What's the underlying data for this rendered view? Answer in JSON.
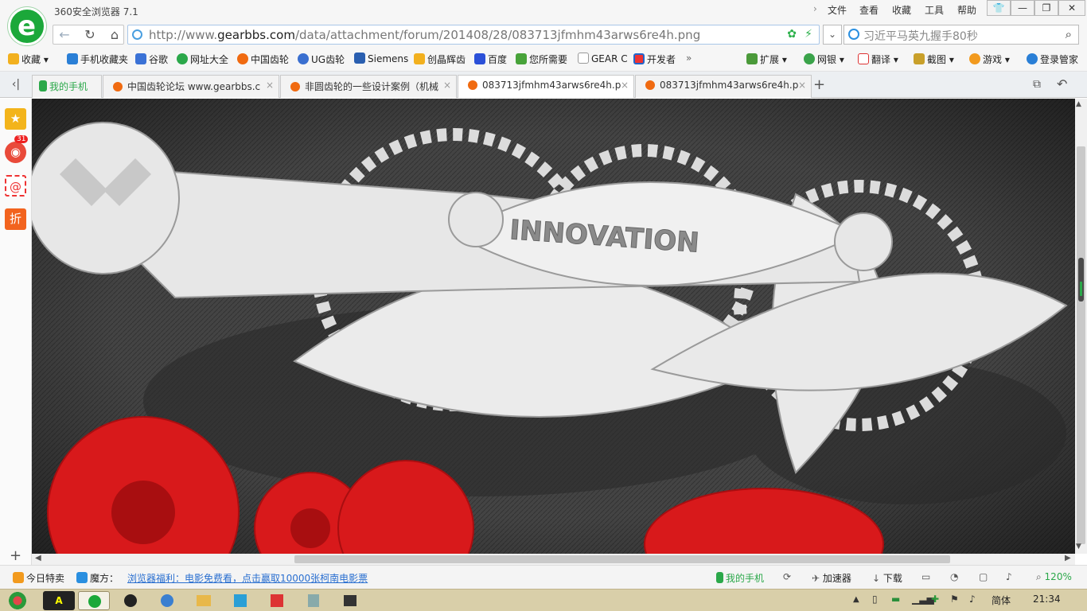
{
  "window": {
    "title": "360安全浏览器 7.1",
    "menus": [
      "文件",
      "查看",
      "收藏",
      "工具",
      "帮助"
    ]
  },
  "address": {
    "url_prefix": "http://www.",
    "url_domain": "gearbbs.com",
    "url_path": "/data/attachment/forum/201408/28/083713jfmhm43arws6re4h.png"
  },
  "search": {
    "placeholder": "习近平马英九握手80秒"
  },
  "bookmarks": {
    "left": [
      "收藏",
      "手机收藏夹",
      "谷歌",
      "网址大全",
      "中国齿轮",
      "UG齿轮",
      "Siemens",
      "创晶辉齿",
      "百度",
      "您所需要",
      "GEAR C",
      "开发者"
    ],
    "more": "»",
    "right": [
      "扩展",
      "网银",
      "翻译",
      "截图",
      "游戏",
      "登录管家"
    ]
  },
  "tabs": [
    {
      "label": "我的手机",
      "active": false
    },
    {
      "label": "中国齿轮论坛 www.gearbbs.c",
      "active": false
    },
    {
      "label": "非圆齿轮的一些设计案例（机械",
      "active": false
    },
    {
      "label": "083713jfmhm43arws6re4h.p",
      "active": true
    },
    {
      "label": "083713jfmhm43arws6re4h.p",
      "active": false
    }
  ],
  "sidebar": {
    "weibo_badge": "31"
  },
  "content": {
    "gear_text": "INNOVATION"
  },
  "status": {
    "left1": "今日特卖",
    "left2": "魔方：",
    "promo": "浏览器福利：电影免费看，点击赢取10000张柯南电影票",
    "phone": "我的手机",
    "accel": "加速器",
    "download": "下载",
    "zoom": "120%"
  },
  "taskbar": {
    "lang": "简体",
    "time": "21:34"
  },
  "colors": {
    "brand": "#1ba83a",
    "gear_red": "#d8191b",
    "gear_white": "#e7e7e7"
  }
}
